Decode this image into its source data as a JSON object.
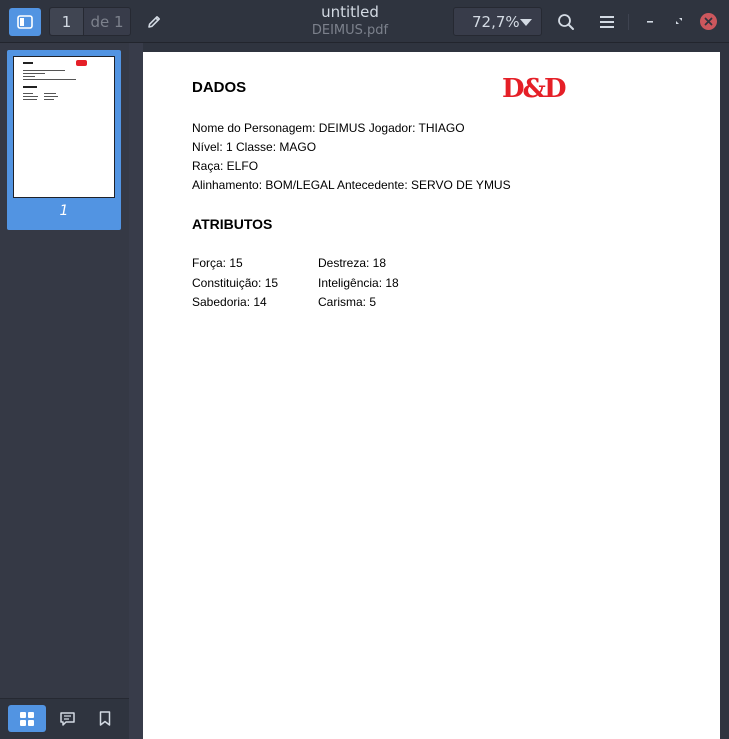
{
  "toolbar": {
    "current_page": "1",
    "page_total": "de 1",
    "zoom": "72,7%"
  },
  "window": {
    "title": "untitled",
    "filename": "DEIMUS.pdf"
  },
  "sidebar": {
    "thumbnail_page_number": "1",
    "active_view": "thumbnails"
  },
  "document": {
    "logo_text": "D&D",
    "heading_data": "DADOS",
    "details": [
      "Nome do Personagem: DEIMUS  Jogador: THIAGO",
      "Nível: 1  Classe: MAGO",
      "Raça: ELFO",
      "Alinhamento: BOM/LEGAL  Antecedente: SERVO DE YMUS"
    ],
    "heading_attributes": "ATRIBUTOS",
    "attributes_left": [
      "Força: 15",
      "Constituição: 15",
      "Sabedoria: 14"
    ],
    "attributes_right": [
      "Destreza: 18",
      "Inteligência: 18",
      "Carisma: 5"
    ]
  },
  "colors": {
    "accent": "#5294e2",
    "close": "#cc575d",
    "logo": "#e51f27"
  }
}
